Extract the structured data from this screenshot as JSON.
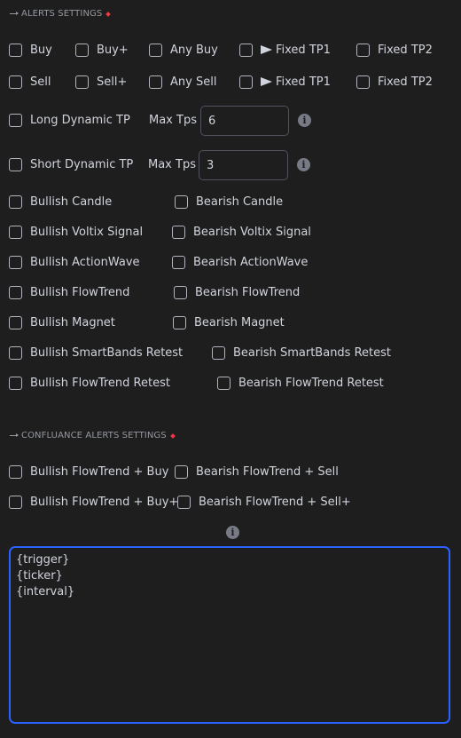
{
  "alerts": {
    "header": "ALERTS SETTINGS",
    "row_buy": [
      {
        "label": "Buy",
        "checked": false
      },
      {
        "label": "Buy+",
        "checked": false
      },
      {
        "label": "Any Buy",
        "checked": false
      },
      {
        "label": "Fixed TP1",
        "checked": false,
        "icon": "arrow-right-icon"
      },
      {
        "label": "Fixed TP2",
        "checked": false
      }
    ],
    "row_sell": [
      {
        "label": "Sell",
        "checked": false
      },
      {
        "label": "Sell+",
        "checked": false
      },
      {
        "label": "Any Sell",
        "checked": false
      },
      {
        "label": "Fixed TP1",
        "checked": false,
        "icon": "arrow-right-icon"
      },
      {
        "label": "Fixed TP2",
        "checked": false
      }
    ],
    "long_dynamic": {
      "label": "Long Dynamic TP",
      "max_label": "Max Tps",
      "value": "6"
    },
    "short_dynamic": {
      "label": "Short Dynamic TP",
      "max_label": "Max Tps",
      "value": "3"
    },
    "pairs": [
      {
        "bull": "Bullish Candle",
        "bear": "Bearish Candle"
      },
      {
        "bull": "Bullish Voltix Signal",
        "bear": "Bearish Voltix Signal"
      },
      {
        "bull": "Bullish ActionWave",
        "bear": "Bearish ActionWave"
      },
      {
        "bull": "Bullish FlowTrend",
        "bear": "Bearish FlowTrend"
      },
      {
        "bull": "Bullish Magnet",
        "bear": "Bearish Magnet"
      },
      {
        "bull": "Bullish SmartBands Retest",
        "bear": "Bearish SmartBands Retest"
      },
      {
        "bull": "Bullish FlowTrend Retest",
        "bear": "Bearish FlowTrend Retest"
      }
    ]
  },
  "confluence": {
    "header": "CONFLUANCE ALERTS SETTINGS",
    "pairs": [
      {
        "bull": "Bullish FlowTrend + Buy",
        "bear": "Bearish FlowTrend + Sell"
      },
      {
        "bull": "Bullish FlowTrend + Buy+",
        "bear": "Bearish FlowTrend + Sell+"
      }
    ]
  },
  "message": {
    "lines": [
      "{trigger}",
      "{ticker}",
      "{interval}"
    ]
  },
  "colors": {
    "background": "#1e1e1e",
    "text": "#d1d4dc",
    "accent_focus": "#2962ff",
    "diamond": "#f23645"
  }
}
